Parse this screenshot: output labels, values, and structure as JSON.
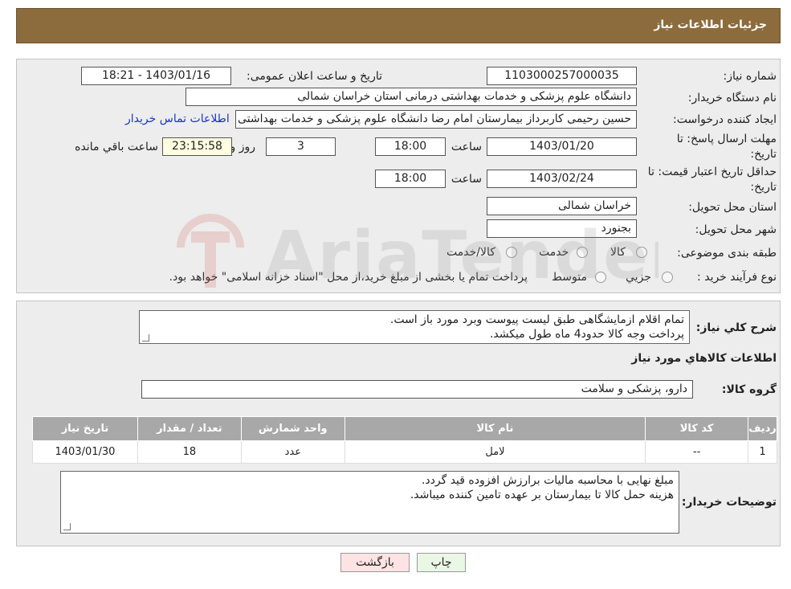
{
  "header": {
    "title": "جزئیات اطلاعات نیاز"
  },
  "form": {
    "need_number_label": "شماره نیاز:",
    "need_number": "1103000257000035",
    "announce_label": "تاریخ و ساعت اعلان عمومی:",
    "announce_value": "1403/01/16 - 18:21",
    "buyer_org_label": "نام دستگاه خریدار:",
    "buyer_org": "دانشگاه علوم پزشکی و خدمات بهداشتی درمانی استان خراسان شمالی",
    "creator_label": "ایجاد کننده درخواست:",
    "creator": "حسین رحیمی کاربرداز بیمارستان امام رضا دانشگاه علوم پزشکی و خدمات بهداشتی",
    "contact_link": "اطلاعات تماس خریدار",
    "deadline_label_1": "مهلت ارسال پاسخ: تا",
    "deadline_label_2": "تاریخ:",
    "deadline_date": "1403/01/20",
    "time_label": "ساعت",
    "deadline_time": "18:00",
    "days_value": "3",
    "days_label": "روز و",
    "remaining_time": "23:15:58",
    "remaining_label": "ساعت باقي مانده",
    "validity_label_1": "حداقل تاریخ اعتبار قیمت: تا",
    "validity_label_2": "تاریخ:",
    "validity_date": "1403/02/24",
    "validity_time": "18:00",
    "province_label": "استان محل تحویل:",
    "province": "خراسان شمالی",
    "city_label": "شهر محل تحویل:",
    "city": "بجنورد",
    "category_label": "طبقه بندی موضوعی:",
    "category_options": [
      "کالا",
      "خدمت",
      "کالا/خدمت"
    ],
    "process_label": "نوع فرآیند خرید :",
    "process_options": [
      "جزیي",
      "متوسط"
    ],
    "payment_note": "پرداخت تمام یا بخشی از مبلغ خرید،از محل \"اسناد خزانه اسلامی\" خواهد بود."
  },
  "description": {
    "label": "شرح کلي نياز:",
    "lines": [
      "تمام اقلام ازمایشگاهی طبق لیست پیوست وبرد مورد باز است.",
      "پرداخت وجه کالا حدود4 ماه طول میکشد."
    ]
  },
  "items_section": {
    "title": "اطلاعات کالاهاي مورد نياز",
    "group_label": "گروه کالا:",
    "group_value": "دارو، پزشکی و سلامت",
    "columns": [
      "رديف",
      "کد کالا",
      "نام کالا",
      "واحد شمارش",
      "تعداد / مقدار",
      "تاریخ نیاز"
    ],
    "rows": [
      [
        "1",
        "--",
        "لامل",
        "عدد",
        "18",
        "1403/01/30"
      ]
    ]
  },
  "buyer_notes": {
    "label": "توضیحات خریدار:",
    "lines": [
      "مبلغ نهایی با محاسبه مالیات برارزش افزوده قید گردد.",
      "هزینه حمل کالا تا بیمارستان بر عهده تامین کننده میباشد."
    ]
  },
  "buttons": {
    "print": "چاپ",
    "back": "بازگشت"
  },
  "watermark": {
    "text": "AriaTender.neT"
  },
  "colors": {
    "header": "#8c6b3c",
    "link": "#1a33cc",
    "back_button": "#fde3e3",
    "print_button": "#eaf7e6"
  }
}
